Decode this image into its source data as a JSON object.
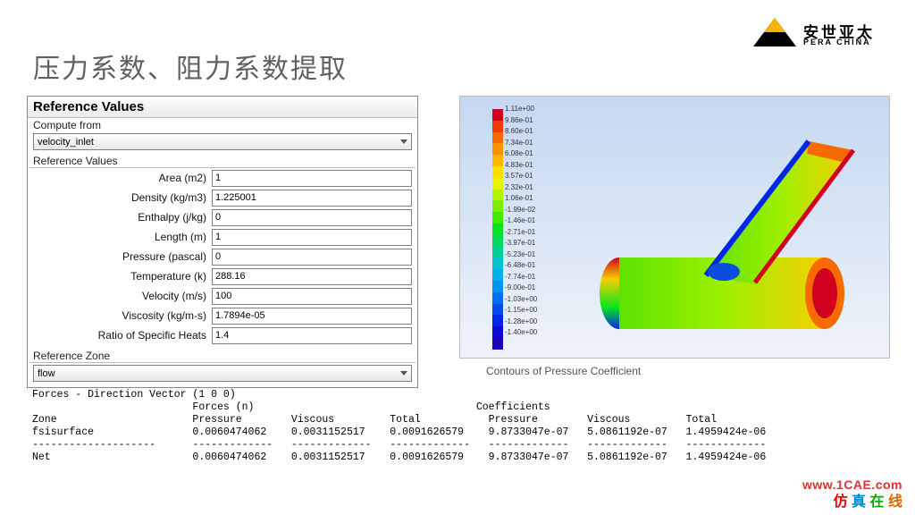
{
  "title": "压力系数、阻力系数提取",
  "logo": {
    "cn": "安世亚太",
    "en": "PERA CHINA"
  },
  "panel": {
    "title": "Reference Values",
    "compute_from_label": "Compute from",
    "compute_from_value": "velocity_inlet",
    "ref_values_label": "Reference Values",
    "rows": [
      {
        "label": "Area (m2)",
        "value": "1"
      },
      {
        "label": "Density (kg/m3)",
        "value": "1.225001"
      },
      {
        "label": "Enthalpy (j/kg)",
        "value": "0"
      },
      {
        "label": "Length (m)",
        "value": "1"
      },
      {
        "label": "Pressure (pascal)",
        "value": "0"
      },
      {
        "label": "Temperature (k)",
        "value": "288.16"
      },
      {
        "label": "Velocity (m/s)",
        "value": "100"
      },
      {
        "label": "Viscosity (kg/m-s)",
        "value": "1.7894e-05"
      },
      {
        "label": "Ratio of Specific Heats",
        "value": "1.4"
      }
    ],
    "ref_zone_label": "Reference Zone",
    "ref_zone_value": "flow"
  },
  "legend": [
    "1.11e+00",
    "9.86e-01",
    "8.60e-01",
    "7.34e-01",
    "6.08e-01",
    "4.83e-01",
    "3.57e-01",
    "2.32e-01",
    "1.06e-01",
    "-1.99e-02",
    "-1.46e-01",
    "-2.71e-01",
    "-3.97e-01",
    "-5.23e-01",
    "-6.48e-01",
    "-7.74e-01",
    "-9.00e-01",
    "-1.03e+00",
    "-1.15e+00",
    "-1.28e+00",
    "-1.40e+00"
  ],
  "legend_colors": [
    "#d1001f",
    "#ef3a00",
    "#f66a00",
    "#fb9100",
    "#fcb800",
    "#fddf00",
    "#e7f600",
    "#b2f300",
    "#7aef00",
    "#40ea00",
    "#07e41e",
    "#00da5a",
    "#00cf95",
    "#00c3cb",
    "#00b0e9",
    "#0093f0",
    "#006ef2",
    "#004af0",
    "#0027e9",
    "#0c08d8",
    "#1f00b7"
  ],
  "contour_caption": "Contours of Pressure Coefficient",
  "forces_text": "Forces - Direction Vector (1 0 0)\n                          Forces (n)                                    Coefficients\nZone                      Pressure        Viscous         Total           Pressure        Viscous         Total\nfsisurface                0.0060474062    0.0031152517    0.0091626579    9.8733047e-07   5.0861192e-07   1.4959424e-06\n--------------------      -------------   -------------   -------------   -------------   -------------   -------------\nNet                       0.0060474062    0.0031152517    0.0091626579    9.8733047e-07   5.0861192e-07   1.4959424e-06",
  "wm_url": "www.1CAE.com",
  "wm_txt": {
    "a": "仿",
    "b": "真",
    "c": "在",
    "d": "线"
  }
}
